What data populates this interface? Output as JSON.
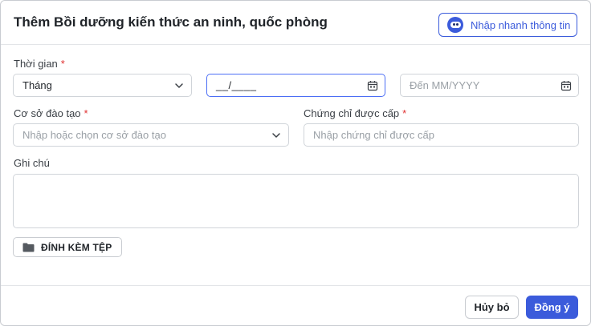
{
  "dialog": {
    "title": "Thêm Bồi dưỡng kiến thức an ninh, quốc phòng",
    "quick_fill_label": "Nhập nhanh thông tin"
  },
  "time": {
    "label": "Thời gian",
    "period_value": "Tháng",
    "from_value": "__/____",
    "to_placeholder": "Đến MM/YYYY"
  },
  "institution": {
    "label": "Cơ sở đào tạo",
    "placeholder": "Nhập hoặc chọn cơ sở đào tạo"
  },
  "certificate": {
    "label": "Chứng chỉ được cấp",
    "placeholder": "Nhập chứng chỉ được cấp"
  },
  "note": {
    "label": "Ghi chú"
  },
  "attach": {
    "label": "ĐÍNH KÈM TỆP"
  },
  "required_mark": "*",
  "footer": {
    "cancel_label": "Hủy bỏ",
    "ok_label": "Đồng ý"
  },
  "colors": {
    "primary": "#3b5bdb",
    "required": "#e03131",
    "focus_border": "#4c6ef5"
  }
}
